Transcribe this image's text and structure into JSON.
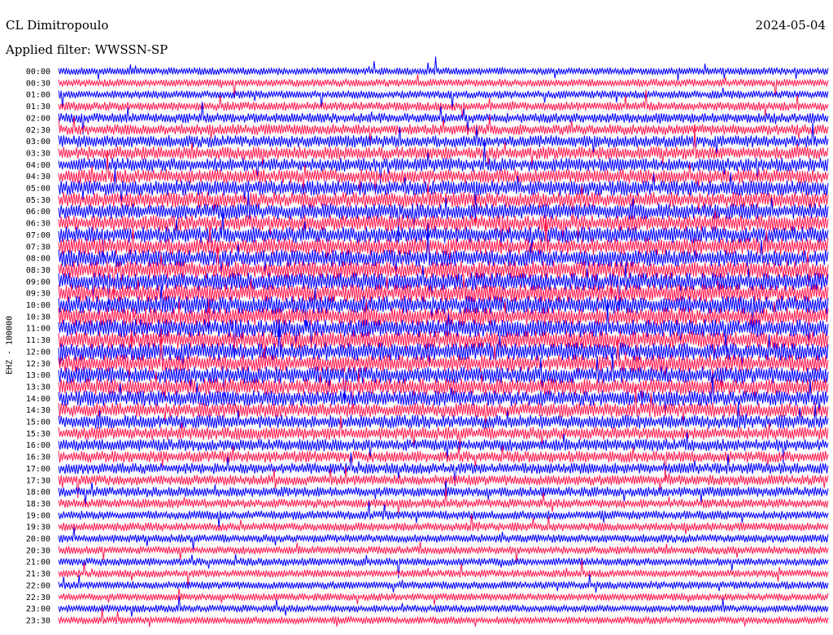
{
  "header": {
    "station": "CL Dimitropoulo",
    "date": "2024-05-04",
    "filter": "Applied filter: WWSSN-SP"
  },
  "chart_data": {
    "type": "line",
    "ylabel": "EHZ - 100000",
    "row_labels": [
      "00:00",
      "00:30",
      "01:00",
      "01:30",
      "02:00",
      "02:30",
      "03:00",
      "03:30",
      "04:00",
      "04:30",
      "05:00",
      "05:30",
      "06:00",
      "06:30",
      "07:00",
      "07:30",
      "08:00",
      "08:30",
      "09:00",
      "09:30",
      "10:00",
      "10:30",
      "11:00",
      "11:30",
      "12:00",
      "12:30",
      "13:00",
      "13:30",
      "14:00",
      "14:30",
      "15:00",
      "15:30",
      "16:00",
      "16:30",
      "17:00",
      "17:30",
      "18:00",
      "18:30",
      "19:00",
      "19:30",
      "20:00",
      "20:30",
      "21:00",
      "21:30",
      "22:00",
      "22:30",
      "23:00",
      "23:30"
    ],
    "series_colors": [
      "#0000ff",
      "#ff1a4f"
    ],
    "relative_noise_level": [
      0.18,
      0.2,
      0.22,
      0.28,
      0.35,
      0.42,
      0.5,
      0.55,
      0.6,
      0.65,
      0.7,
      0.72,
      0.75,
      0.78,
      0.8,
      0.82,
      0.85,
      0.86,
      0.88,
      0.88,
      0.9,
      0.9,
      0.9,
      0.88,
      0.88,
      0.85,
      0.82,
      0.78,
      0.72,
      0.66,
      0.6,
      0.55,
      0.5,
      0.46,
      0.42,
      0.38,
      0.34,
      0.3,
      0.28,
      0.26,
      0.24,
      0.22,
      0.22,
      0.2,
      0.2,
      0.18,
      0.18,
      0.18
    ]
  }
}
